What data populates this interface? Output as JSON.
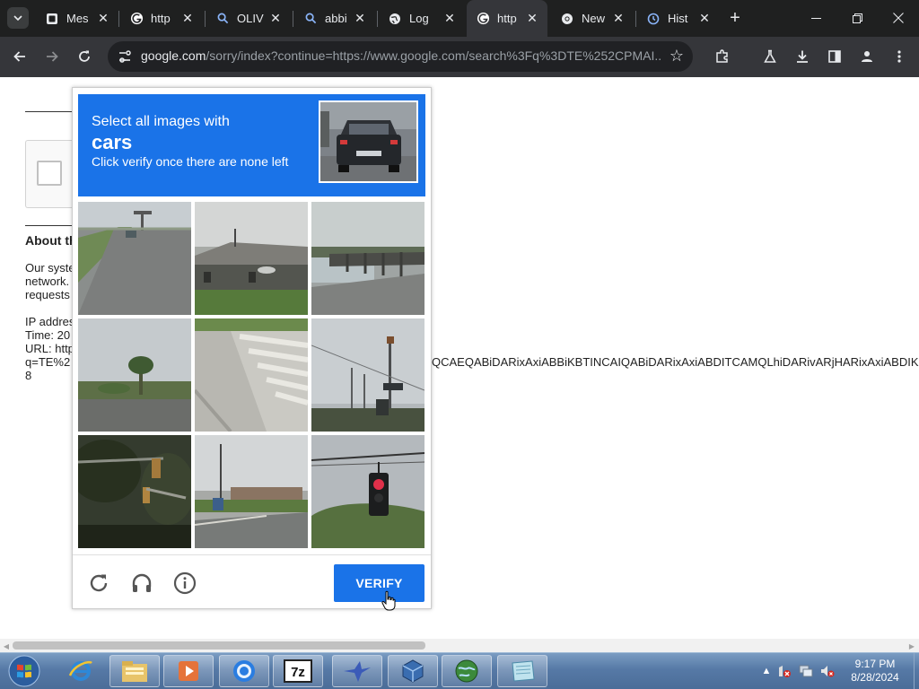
{
  "browser": {
    "tabs": [
      {
        "title": "Mes",
        "favicon": "messages-icon",
        "active": false
      },
      {
        "title": "http",
        "favicon": "google-icon",
        "active": false
      },
      {
        "title": "OLIV",
        "favicon": "search-icon",
        "active": false
      },
      {
        "title": "abbi",
        "favicon": "search-icon",
        "active": false
      },
      {
        "title": "Log",
        "favicon": "globe-icon",
        "active": false
      },
      {
        "title": "http",
        "favicon": "google-icon",
        "active": true
      },
      {
        "title": "New",
        "favicon": "chrome-icon",
        "active": false
      },
      {
        "title": "Hist",
        "favicon": "history-icon",
        "active": false
      }
    ],
    "url_host": "google.com",
    "url_path": "/sorry/index?continue=https://www.google.com/search%3Fq%3DTE%252CPMAI..."
  },
  "page": {
    "about_heading": "About th",
    "line1": "Our syste",
    "line2": "network.",
    "line3": "requests",
    "ip_label": "IP addres",
    "time_label": "Time: 20",
    "url_label": "URL: http",
    "q_label": "q=TE%2",
    "last_char": "8",
    "long_param": "QCAEQABiDARixAxiABBiKBTINCAIQABiDARixAxiABDITCAMQLhiDARivARjHARixAxiABDIK"
  },
  "captcha": {
    "prompt_line1": "Select all images with",
    "prompt_target": "cars",
    "prompt_line3": "Click verify once there are none left",
    "verify_label": "VERIFY",
    "colors": {
      "primary": "#1a73e8"
    }
  },
  "taskbar": {
    "time": "9:17 PM",
    "date": "8/28/2024"
  }
}
